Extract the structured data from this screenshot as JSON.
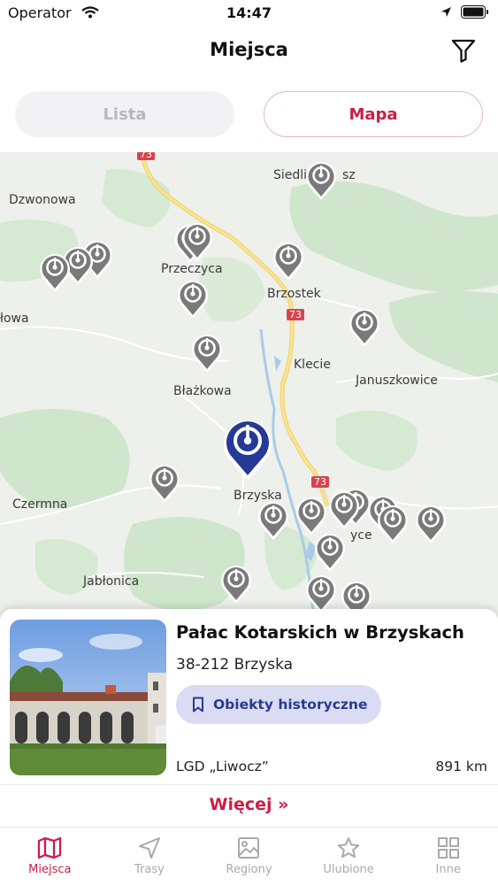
{
  "status_bar": {
    "carrier": "Operator",
    "time": "14:47"
  },
  "nav": {
    "title": "Miejsca"
  },
  "segments": {
    "list": "Lista",
    "map": "Mapa",
    "active": "map"
  },
  "map": {
    "places": [
      "Siedliska",
      "sz",
      "Dzwonowa",
      "Przeczyca",
      "Brzostek",
      "łowa",
      "Klecie",
      "Januszkowice",
      "Błażkowa",
      "Brzyska",
      "Czermna",
      "yce",
      "Jabłonica"
    ],
    "road_labels": [
      "73",
      "73",
      "73"
    ]
  },
  "card": {
    "title": "Pałac Kotarskich w Brzyskach",
    "address": "38-212 Brzyska",
    "tag": "Obiekty historyczne",
    "organization": "LGD „Liwocz”",
    "distance": "891 km",
    "more_label": "Więcej »"
  },
  "tabs": [
    {
      "label": "Miejsca",
      "icon": "map-icon",
      "active": true
    },
    {
      "label": "Trasy",
      "icon": "navigation-arrow-icon",
      "active": false
    },
    {
      "label": "Regiony",
      "icon": "image-icon",
      "active": false
    },
    {
      "label": "Ulubione",
      "icon": "star-icon",
      "active": false
    },
    {
      "label": "Inne",
      "icon": "grid-icon",
      "active": false
    }
  ],
  "colors": {
    "accent": "#cc1d46",
    "selected_pin": "#243a96",
    "pin": "#7a7a7a",
    "tag_bg": "#d9dcf2"
  }
}
